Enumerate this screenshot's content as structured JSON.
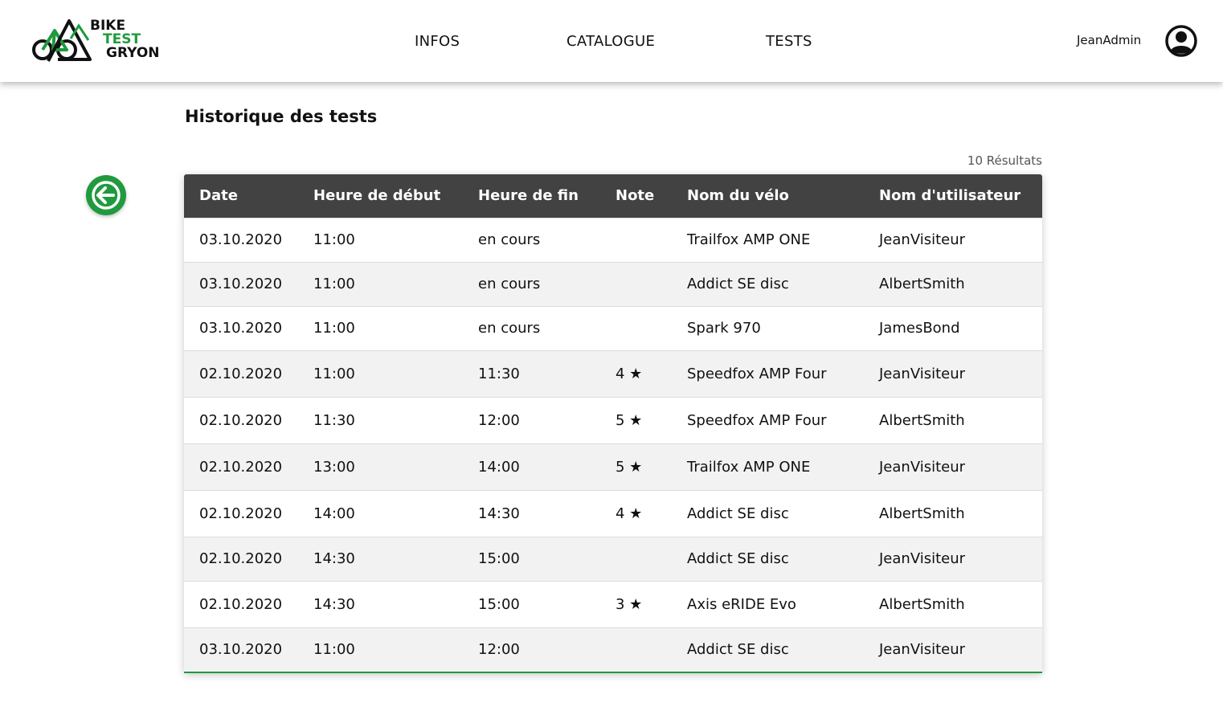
{
  "header": {
    "logo": {
      "line1": "BIKE",
      "line2": "TEST",
      "line3": "GRYON"
    },
    "nav": [
      {
        "label": "INFOS"
      },
      {
        "label": "CATALOGUE"
      },
      {
        "label": "TESTS"
      }
    ],
    "username": "JeanAdmin"
  },
  "page": {
    "title": "Historique des tests",
    "result_count": "10 Résultats"
  },
  "colors": {
    "accent": "#1f9a3e",
    "table_header": "#424242"
  },
  "table": {
    "columns": [
      "Date",
      "Heure de début",
      "Heure de fin",
      "Note",
      "Nom du vélo",
      "Nom d'utilisateur"
    ],
    "rows": [
      {
        "date": "03.10.2020",
        "start": "11:00",
        "end": "en cours",
        "note": "",
        "bike": "Trailfox AMP ONE",
        "user": "JeanVisiteur"
      },
      {
        "date": "03.10.2020",
        "start": "11:00",
        "end": "en cours",
        "note": "",
        "bike": "Addict SE disc",
        "user": "AlbertSmith"
      },
      {
        "date": "03.10.2020",
        "start": "11:00",
        "end": "en cours",
        "note": "",
        "bike": "Spark 970",
        "user": "JamesBond"
      },
      {
        "date": "02.10.2020",
        "start": "11:00",
        "end": "11:30",
        "note": "4 ★",
        "bike": "Speedfox AMP Four",
        "user": "JeanVisiteur"
      },
      {
        "date": "02.10.2020",
        "start": "11:30",
        "end": "12:00",
        "note": "5 ★",
        "bike": "Speedfox AMP Four",
        "user": "AlbertSmith"
      },
      {
        "date": "02.10.2020",
        "start": "13:00",
        "end": "14:00",
        "note": "5 ★",
        "bike": "Trailfox AMP ONE",
        "user": "JeanVisiteur"
      },
      {
        "date": "02.10.2020",
        "start": "14:00",
        "end": "14:30",
        "note": "4 ★",
        "bike": "Addict SE disc",
        "user": "AlbertSmith"
      },
      {
        "date": "02.10.2020",
        "start": "14:30",
        "end": "15:00",
        "note": "",
        "bike": "Addict SE disc",
        "user": "JeanVisiteur"
      },
      {
        "date": "02.10.2020",
        "start": "14:30",
        "end": "15:00",
        "note": "3 ★",
        "bike": "Axis eRIDE Evo",
        "user": "AlbertSmith"
      },
      {
        "date": "03.10.2020",
        "start": "11:00",
        "end": "12:00",
        "note": "",
        "bike": "Addict SE disc",
        "user": "JeanVisiteur"
      }
    ]
  }
}
